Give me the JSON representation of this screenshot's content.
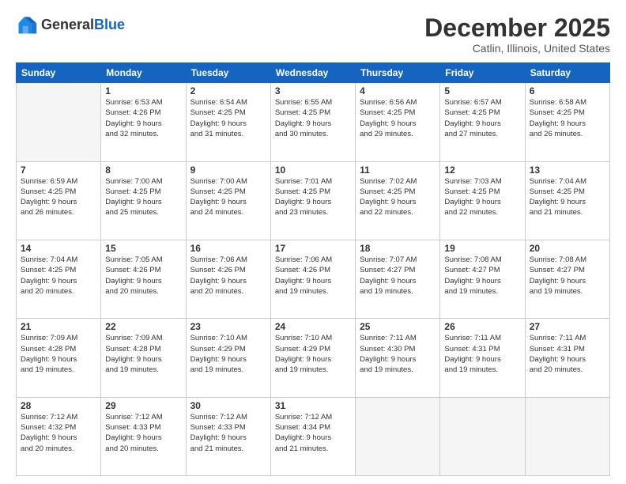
{
  "header": {
    "logo_line1": "General",
    "logo_line2": "Blue",
    "month_title": "December 2025",
    "location": "Catlin, Illinois, United States"
  },
  "weekdays": [
    "Sunday",
    "Monday",
    "Tuesday",
    "Wednesday",
    "Thursday",
    "Friday",
    "Saturday"
  ],
  "weeks": [
    [
      {
        "day": "",
        "info": ""
      },
      {
        "day": "1",
        "info": "Sunrise: 6:53 AM\nSunset: 4:26 PM\nDaylight: 9 hours\nand 32 minutes."
      },
      {
        "day": "2",
        "info": "Sunrise: 6:54 AM\nSunset: 4:25 PM\nDaylight: 9 hours\nand 31 minutes."
      },
      {
        "day": "3",
        "info": "Sunrise: 6:55 AM\nSunset: 4:25 PM\nDaylight: 9 hours\nand 30 minutes."
      },
      {
        "day": "4",
        "info": "Sunrise: 6:56 AM\nSunset: 4:25 PM\nDaylight: 9 hours\nand 29 minutes."
      },
      {
        "day": "5",
        "info": "Sunrise: 6:57 AM\nSunset: 4:25 PM\nDaylight: 9 hours\nand 27 minutes."
      },
      {
        "day": "6",
        "info": "Sunrise: 6:58 AM\nSunset: 4:25 PM\nDaylight: 9 hours\nand 26 minutes."
      }
    ],
    [
      {
        "day": "7",
        "info": "Sunrise: 6:59 AM\nSunset: 4:25 PM\nDaylight: 9 hours\nand 26 minutes."
      },
      {
        "day": "8",
        "info": "Sunrise: 7:00 AM\nSunset: 4:25 PM\nDaylight: 9 hours\nand 25 minutes."
      },
      {
        "day": "9",
        "info": "Sunrise: 7:00 AM\nSunset: 4:25 PM\nDaylight: 9 hours\nand 24 minutes."
      },
      {
        "day": "10",
        "info": "Sunrise: 7:01 AM\nSunset: 4:25 PM\nDaylight: 9 hours\nand 23 minutes."
      },
      {
        "day": "11",
        "info": "Sunrise: 7:02 AM\nSunset: 4:25 PM\nDaylight: 9 hours\nand 22 minutes."
      },
      {
        "day": "12",
        "info": "Sunrise: 7:03 AM\nSunset: 4:25 PM\nDaylight: 9 hours\nand 22 minutes."
      },
      {
        "day": "13",
        "info": "Sunrise: 7:04 AM\nSunset: 4:25 PM\nDaylight: 9 hours\nand 21 minutes."
      }
    ],
    [
      {
        "day": "14",
        "info": "Sunrise: 7:04 AM\nSunset: 4:25 PM\nDaylight: 9 hours\nand 20 minutes."
      },
      {
        "day": "15",
        "info": "Sunrise: 7:05 AM\nSunset: 4:26 PM\nDaylight: 9 hours\nand 20 minutes."
      },
      {
        "day": "16",
        "info": "Sunrise: 7:06 AM\nSunset: 4:26 PM\nDaylight: 9 hours\nand 20 minutes."
      },
      {
        "day": "17",
        "info": "Sunrise: 7:06 AM\nSunset: 4:26 PM\nDaylight: 9 hours\nand 19 minutes."
      },
      {
        "day": "18",
        "info": "Sunrise: 7:07 AM\nSunset: 4:27 PM\nDaylight: 9 hours\nand 19 minutes."
      },
      {
        "day": "19",
        "info": "Sunrise: 7:08 AM\nSunset: 4:27 PM\nDaylight: 9 hours\nand 19 minutes."
      },
      {
        "day": "20",
        "info": "Sunrise: 7:08 AM\nSunset: 4:27 PM\nDaylight: 9 hours\nand 19 minutes."
      }
    ],
    [
      {
        "day": "21",
        "info": "Sunrise: 7:09 AM\nSunset: 4:28 PM\nDaylight: 9 hours\nand 19 minutes."
      },
      {
        "day": "22",
        "info": "Sunrise: 7:09 AM\nSunset: 4:28 PM\nDaylight: 9 hours\nand 19 minutes."
      },
      {
        "day": "23",
        "info": "Sunrise: 7:10 AM\nSunset: 4:29 PM\nDaylight: 9 hours\nand 19 minutes."
      },
      {
        "day": "24",
        "info": "Sunrise: 7:10 AM\nSunset: 4:29 PM\nDaylight: 9 hours\nand 19 minutes."
      },
      {
        "day": "25",
        "info": "Sunrise: 7:11 AM\nSunset: 4:30 PM\nDaylight: 9 hours\nand 19 minutes."
      },
      {
        "day": "26",
        "info": "Sunrise: 7:11 AM\nSunset: 4:31 PM\nDaylight: 9 hours\nand 19 minutes."
      },
      {
        "day": "27",
        "info": "Sunrise: 7:11 AM\nSunset: 4:31 PM\nDaylight: 9 hours\nand 20 minutes."
      }
    ],
    [
      {
        "day": "28",
        "info": "Sunrise: 7:12 AM\nSunset: 4:32 PM\nDaylight: 9 hours\nand 20 minutes."
      },
      {
        "day": "29",
        "info": "Sunrise: 7:12 AM\nSunset: 4:33 PM\nDaylight: 9 hours\nand 20 minutes."
      },
      {
        "day": "30",
        "info": "Sunrise: 7:12 AM\nSunset: 4:33 PM\nDaylight: 9 hours\nand 21 minutes."
      },
      {
        "day": "31",
        "info": "Sunrise: 7:12 AM\nSunset: 4:34 PM\nDaylight: 9 hours\nand 21 minutes."
      },
      {
        "day": "",
        "info": ""
      },
      {
        "day": "",
        "info": ""
      },
      {
        "day": "",
        "info": ""
      }
    ]
  ]
}
